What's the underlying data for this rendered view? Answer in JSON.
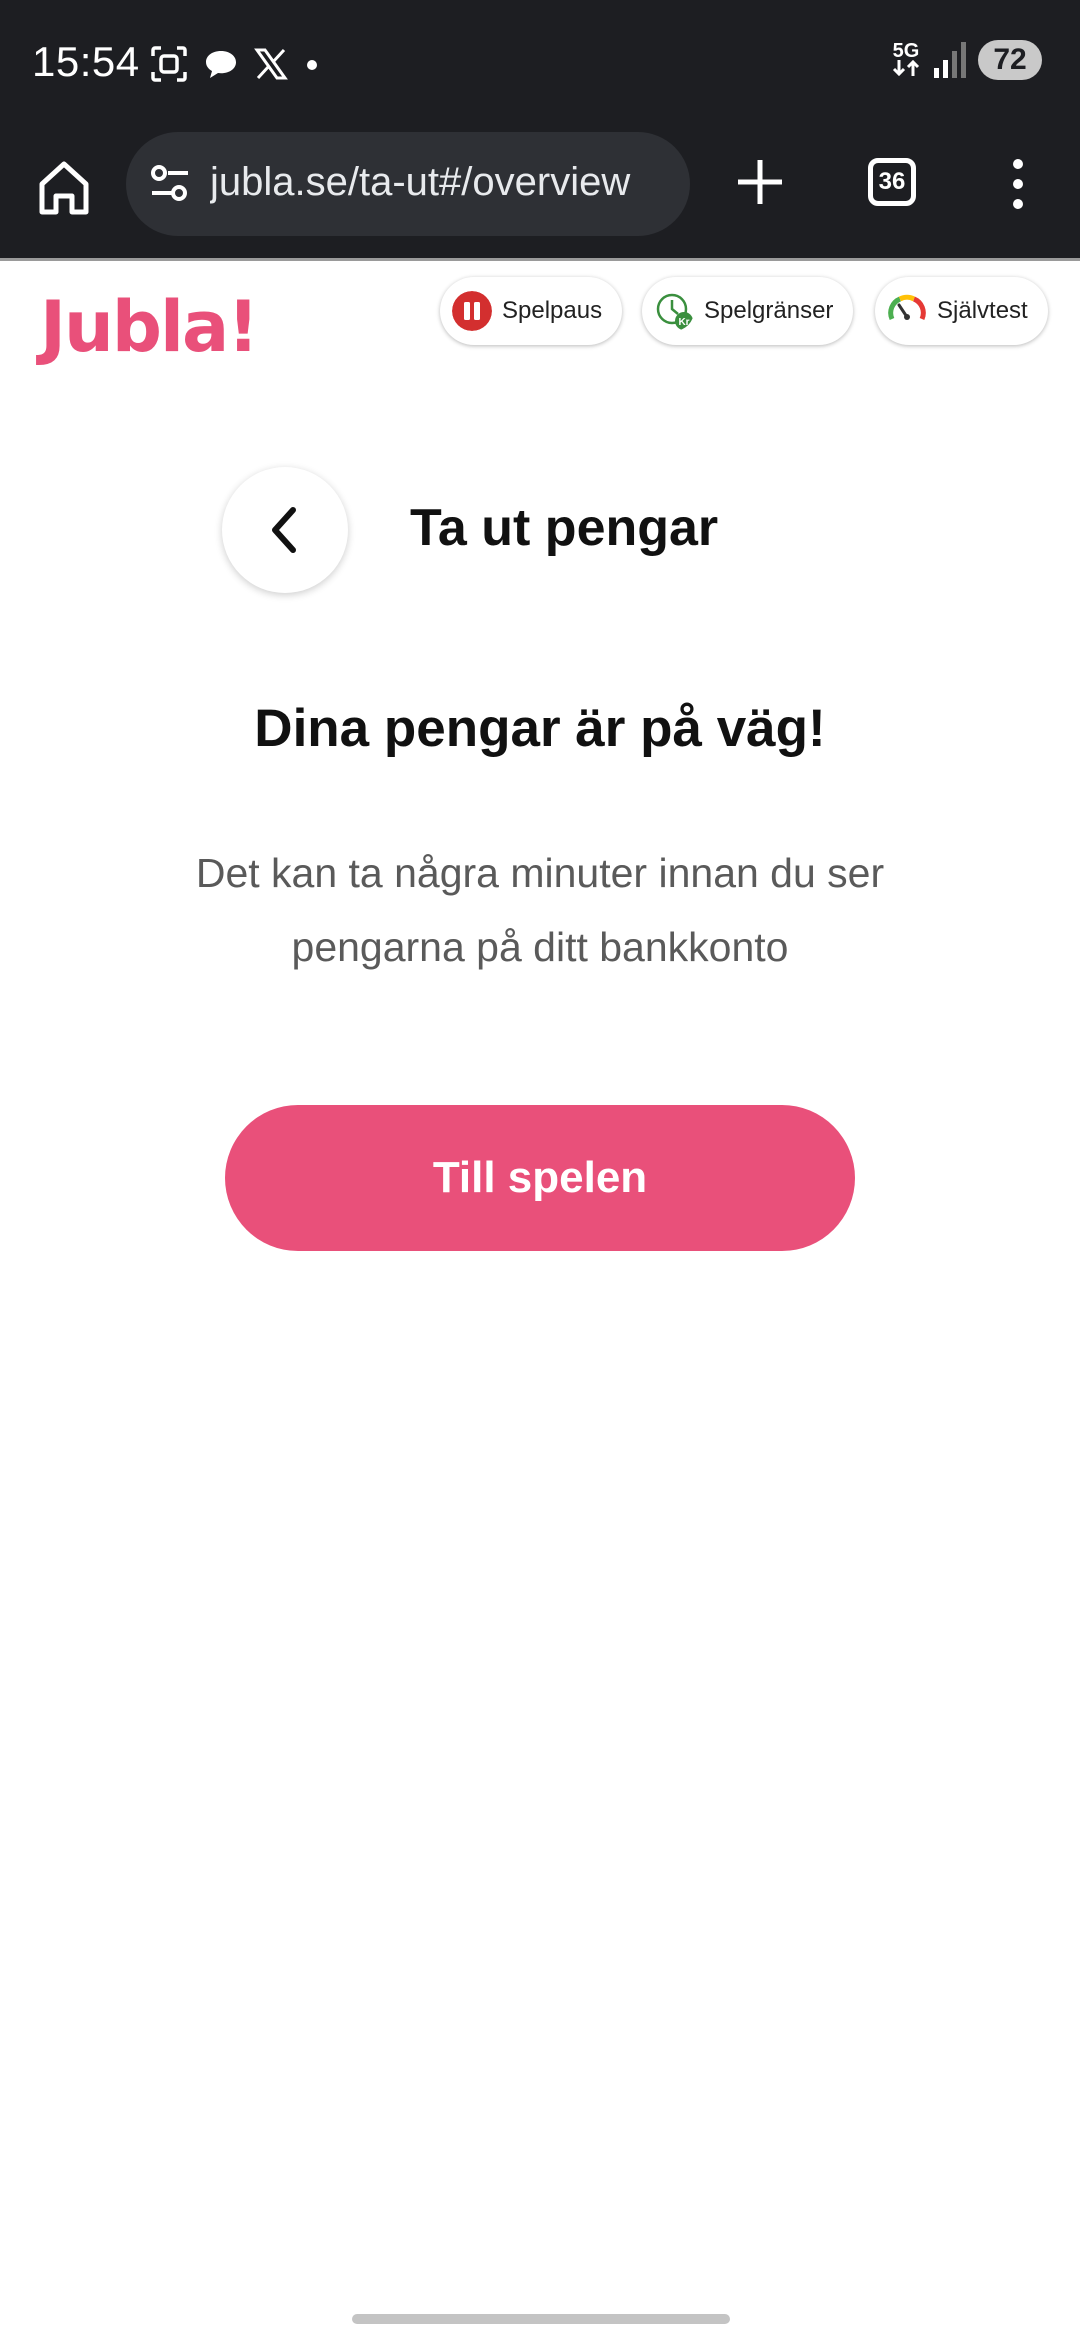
{
  "status_bar": {
    "time": "15:54",
    "network": "5G",
    "battery": "72",
    "icons": [
      "screenshot-icon",
      "chat-bubble-icon",
      "x-logo-icon",
      "notification-dot-icon",
      "signal-icon"
    ]
  },
  "browser": {
    "url": "jubla.se/ta-ut#/overview",
    "tab_count": "36"
  },
  "site_header": {
    "logo": "Jubla!",
    "brand_color": "#e9507a",
    "pills": [
      {
        "label": "Spelpaus",
        "icon": "pause-icon",
        "color": "#d32f2f"
      },
      {
        "label": "Spelgränser",
        "icon": "limits-icon",
        "color": "#3a8f3e"
      },
      {
        "label": "Självtest",
        "icon": "gauge-icon",
        "color": "#e0a020"
      }
    ]
  },
  "page": {
    "title": "Ta ut pengar",
    "headline": "Dina pengar är på väg!",
    "subtext": "Det kan ta några minuter innan du ser pengarna på ditt bankkonto",
    "cta_label": "Till spelen"
  }
}
